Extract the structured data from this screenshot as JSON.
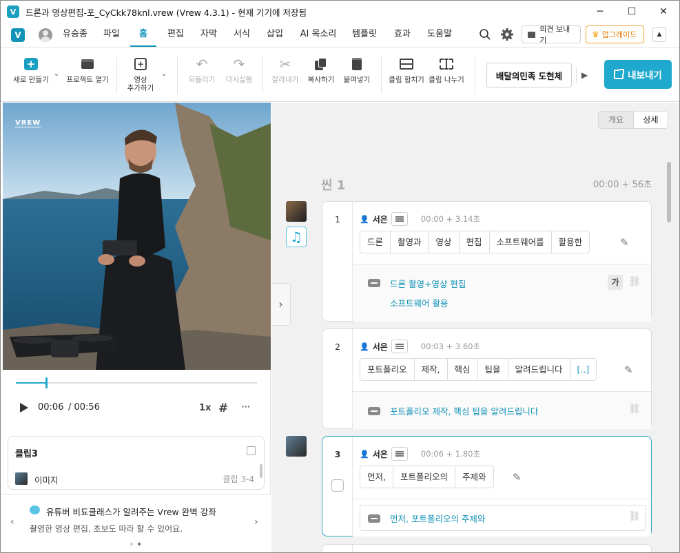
{
  "window": {
    "title": "드론과 영상편집-포_CyCkk78knl.vrew (Vrew 4.3.1) - 현재 기기에 저장됨",
    "app_icon": "V",
    "minimize": "─",
    "maximize": "☐",
    "close": "✕"
  },
  "menubar": {
    "user": "유승종",
    "items": [
      "파일",
      "홈",
      "편집",
      "자막",
      "서식",
      "삽입",
      "AI 목소리",
      "템플릿",
      "효과",
      "도움말"
    ],
    "active": "홈",
    "feedback": "의견 보내기",
    "upgrade": "업그레이드"
  },
  "toolbar": {
    "new": "새로 만들기",
    "open": "프로젝트 열기",
    "add_video_1": "영상",
    "add_video_2": "추가하기",
    "undo": "되돌리기",
    "redo": "다시실행",
    "cut": "잘라내기",
    "copy": "복사하기",
    "paste": "붙여넣기",
    "merge": "클립 합치기",
    "split": "클립 나누기",
    "font": "배달의민족 도현체",
    "export": "내보내기"
  },
  "player": {
    "watermark": "VREW",
    "current_time": "00:06",
    "total_time": "/ 00:56",
    "progress": 0.125,
    "speed": "1x"
  },
  "clip_panel": {
    "title": "클립3",
    "item": "이미지",
    "item_ref": "클립 3-4"
  },
  "promo": {
    "title": "유튜버 비됴클래스가 알려주는 Vrew 완벽 강좌",
    "desc": "촬영한 영상 편집, 초보도 따라 할 수 있어요."
  },
  "view_toggle": {
    "overview": "개요",
    "detail": "상세"
  },
  "scene": {
    "title": "씬 1",
    "time": "00:00 + 56초"
  },
  "clips": [
    {
      "num": "1",
      "speaker": "서은",
      "time": "00:00 + 3.14초",
      "words": [
        "드론",
        "촬영과",
        "영상",
        "편집",
        "소프트웨어를",
        "활용한"
      ],
      "sub1": "드론 촬영+영상 편집",
      "sub2": "소프트웨어 활용",
      "ga": "가"
    },
    {
      "num": "2",
      "speaker": "서은",
      "time": "00:03 + 3.60초",
      "words": [
        "포트폴리오",
        "제작,",
        "핵심",
        "팁을",
        "알려드립니다",
        "[..]"
      ],
      "sub1": "포트폴리오 제작, 핵심 팁을 알려드립니다"
    },
    {
      "num": "3",
      "speaker": "서은",
      "time": "00:06 + 1.80초",
      "words": [
        "먼저,",
        "포트폴리오의",
        "주제와"
      ],
      "sub1": "먼저, 포트폴리오의 주제와"
    }
  ],
  "colors": {
    "accent": "#1493b8",
    "export": "#1fa9ce",
    "upgrade": "#f08a00"
  }
}
